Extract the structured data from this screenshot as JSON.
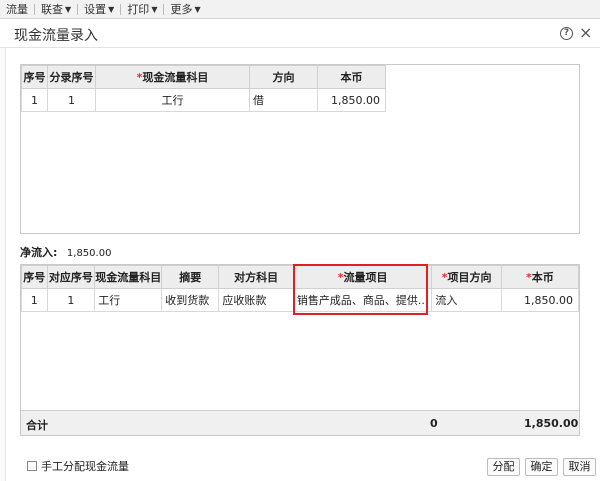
{
  "menubar": {
    "items": [
      {
        "label": "流量",
        "has_caret": false
      },
      {
        "label": "联查",
        "has_caret": true
      },
      {
        "label": "设置",
        "has_caret": true
      },
      {
        "label": "打印",
        "has_caret": true
      },
      {
        "label": "更多",
        "has_caret": true
      }
    ]
  },
  "dialog": {
    "title": "现金流量录入",
    "help_glyph": "?",
    "close_glyph": "×"
  },
  "top_table": {
    "headers": [
      "序号",
      "分录序号",
      "现金流量科目",
      "方向",
      "本币"
    ],
    "required_marker": "*",
    "rows": [
      [
        "1",
        "1",
        "工行",
        "借",
        "1,850.00"
      ]
    ]
  },
  "net_inflow": {
    "label": "净流入:",
    "value": "1,850.00"
  },
  "bottom_table": {
    "headers": [
      "序号",
      "对应序号",
      "现金流量科目",
      "摘要",
      "对方科目",
      "流量项目",
      "项目方向",
      "本币"
    ],
    "required_marker": "*",
    "rows": [
      [
        "1",
        "1",
        "工行",
        "收到货款",
        "应收账款",
        "销售产成品、商品、提供...",
        "流入",
        "1,850.00"
      ]
    ],
    "total": {
      "label": "合计",
      "count": "0",
      "amount": "1,850.00"
    }
  },
  "footer": {
    "checkbox_label": "手工分配现金流量",
    "buttons": {
      "allocate": "分配",
      "ok": "确定",
      "cancel": "取消"
    }
  },
  "colors": {
    "highlight_border": "#e02020",
    "required_marker": "#e03030",
    "header_bg": "#ededed"
  }
}
